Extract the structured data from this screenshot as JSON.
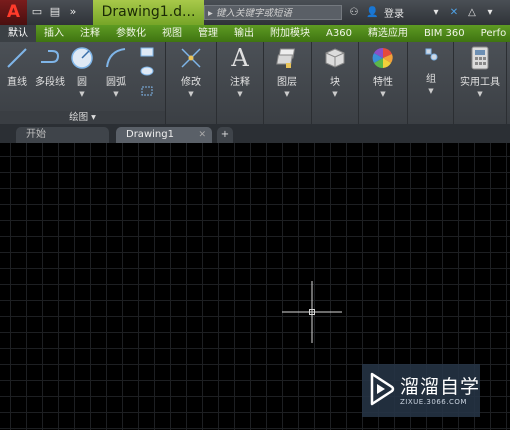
{
  "titlebar": {
    "logo": "A",
    "document_title": "Drawing1.d...",
    "search_placeholder": "键入关键字或短语",
    "login_label": "登录"
  },
  "ribbon_tabs": [
    "默认",
    "插入",
    "注释",
    "参数化",
    "视图",
    "管理",
    "输出",
    "附加模块",
    "A360",
    "精选应用",
    "BIM 360",
    "Perfo"
  ],
  "ribbon": {
    "draw": {
      "line": "直线",
      "polyline": "多段线",
      "circle": "圆",
      "arc": "圆弧",
      "footer": "绘图"
    },
    "modify": "修改",
    "annotation": "注释",
    "layers": "图层",
    "block": "块",
    "properties": "特性",
    "groups": "组",
    "utilities": "实用工具"
  },
  "doc_tabs": {
    "start": "开始",
    "drawing": "Drawing1",
    "new": "+"
  },
  "watermark": {
    "text": "溜溜自学",
    "url": "ZIXUE.3066.COM"
  },
  "colors": {
    "accent_green": "#76a527",
    "app_red": "#ff3b2b",
    "canvas": "#000000"
  }
}
